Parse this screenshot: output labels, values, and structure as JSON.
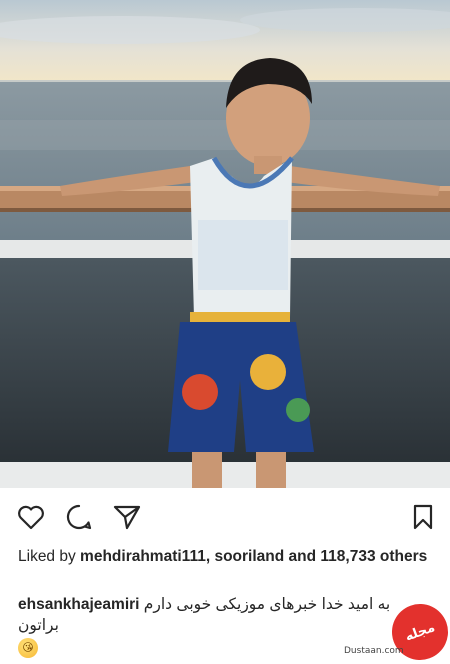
{
  "post": {
    "photo_alt": "",
    "actions": {
      "like_icon": "heart-outline-icon",
      "comment_icon": "comment-bubble-icon",
      "share_icon": "paper-plane-icon",
      "save_icon": "bookmark-icon"
    },
    "likes": {
      "prefix": "Liked by ",
      "user1": "mehdirahmati111",
      "separator": ", ",
      "user2": "sooriland",
      "middle": " and ",
      "count": "118,733",
      "suffix": " others"
    },
    "caption": {
      "username": "ehsankhajeamiri",
      "text": "به امید خدا خبرهای موزیکی خوبی دارم براتون",
      "emoji": "😘"
    }
  },
  "watermark": {
    "logo_text": "مجله دوستان",
    "url": "Dustaan.com"
  },
  "colors": {
    "text": "#262626",
    "background": "#ffffff",
    "watermark_red": "#e3312d"
  }
}
